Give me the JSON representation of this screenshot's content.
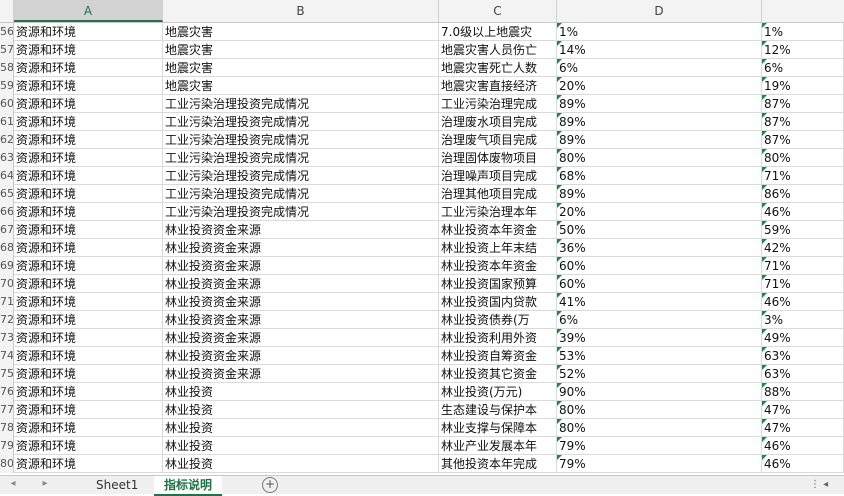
{
  "columns": [
    "A",
    "B",
    "C",
    "D"
  ],
  "selected_column": "A",
  "rows": [
    {
      "n": "56",
      "a": "资源和环境",
      "b": "地震灾害",
      "c": "7.0级以上地震灾",
      "d": "1%",
      "e": "1%"
    },
    {
      "n": "57",
      "a": "资源和环境",
      "b": "地震灾害",
      "c": "地震灾害人员伤亡",
      "d": "14%",
      "e": "12%"
    },
    {
      "n": "58",
      "a": "资源和环境",
      "b": "地震灾害",
      "c": "地震灾害死亡人数",
      "d": "6%",
      "e": "6%"
    },
    {
      "n": "59",
      "a": "资源和环境",
      "b": "地震灾害",
      "c": "地震灾害直接经济",
      "d": "20%",
      "e": "19%"
    },
    {
      "n": "60",
      "a": "资源和环境",
      "b": "工业污染治理投资完成情况",
      "c": "工业污染治理完成",
      "d": "89%",
      "e": "87%"
    },
    {
      "n": "61",
      "a": "资源和环境",
      "b": "工业污染治理投资完成情况",
      "c": "治理废水项目完成",
      "d": "89%",
      "e": "87%"
    },
    {
      "n": "62",
      "a": "资源和环境",
      "b": "工业污染治理投资完成情况",
      "c": "治理废气项目完成",
      "d": "89%",
      "e": "87%"
    },
    {
      "n": "63",
      "a": "资源和环境",
      "b": "工业污染治理投资完成情况",
      "c": "治理固体废物项目",
      "d": "80%",
      "e": "80%"
    },
    {
      "n": "64",
      "a": "资源和环境",
      "b": "工业污染治理投资完成情况",
      "c": "治理噪声项目完成",
      "d": "68%",
      "e": "71%"
    },
    {
      "n": "65",
      "a": "资源和环境",
      "b": "工业污染治理投资完成情况",
      "c": "治理其他项目完成",
      "d": "89%",
      "e": "86%"
    },
    {
      "n": "66",
      "a": "资源和环境",
      "b": "工业污染治理投资完成情况",
      "c": "工业污染治理本年",
      "d": "20%",
      "e": "46%"
    },
    {
      "n": "67",
      "a": "资源和环境",
      "b": "林业投资资金来源",
      "c": "林业投资本年资金",
      "d": "50%",
      "e": "59%"
    },
    {
      "n": "68",
      "a": "资源和环境",
      "b": "林业投资资金来源",
      "c": "林业投资上年末结",
      "d": "36%",
      "e": "42%"
    },
    {
      "n": "69",
      "a": "资源和环境",
      "b": "林业投资资金来源",
      "c": "林业投资本年资金",
      "d": "60%",
      "e": "71%"
    },
    {
      "n": "70",
      "a": "资源和环境",
      "b": "林业投资资金来源",
      "c": "林业投资国家预算",
      "d": "60%",
      "e": "71%"
    },
    {
      "n": "71",
      "a": "资源和环境",
      "b": "林业投资资金来源",
      "c": "林业投资国内贷款",
      "d": "41%",
      "e": "46%"
    },
    {
      "n": "72",
      "a": "资源和环境",
      "b": "林业投资资金来源",
      "c": "林业投资债券(万",
      "d": "6%",
      "e": "3%"
    },
    {
      "n": "73",
      "a": "资源和环境",
      "b": "林业投资资金来源",
      "c": "林业投资利用外资",
      "d": "39%",
      "e": "49%"
    },
    {
      "n": "74",
      "a": "资源和环境",
      "b": "林业投资资金来源",
      "c": "林业投资自筹资金",
      "d": "53%",
      "e": "63%"
    },
    {
      "n": "75",
      "a": "资源和环境",
      "b": "林业投资资金来源",
      "c": "林业投资其它资金",
      "d": "52%",
      "e": "63%"
    },
    {
      "n": "76",
      "a": "资源和环境",
      "b": "林业投资",
      "c": "林业投资(万元)",
      "d": "90%",
      "e": "88%"
    },
    {
      "n": "77",
      "a": "资源和环境",
      "b": "林业投资",
      "c": "生态建设与保护本",
      "d": "80%",
      "e": "47%"
    },
    {
      "n": "78",
      "a": "资源和环境",
      "b": "林业投资",
      "c": "林业支撑与保障本",
      "d": "80%",
      "e": "47%"
    },
    {
      "n": "79",
      "a": "资源和环境",
      "b": "林业投资",
      "c": "林业产业发展本年",
      "d": "79%",
      "e": "46%"
    },
    {
      "n": "80",
      "a": "资源和环境",
      "b": "林业投资",
      "c": "其他投资本年完成",
      "d": "79%",
      "e": "46%"
    }
  ],
  "sheet_tabs": [
    "Sheet1",
    "指标说明"
  ],
  "active_tab": "指标说明",
  "nav": {
    "prev": "◂",
    "next": "▸",
    "add": "+"
  },
  "colors": {
    "accent": "#217346",
    "error_triangle": "#1d8a3c"
  }
}
